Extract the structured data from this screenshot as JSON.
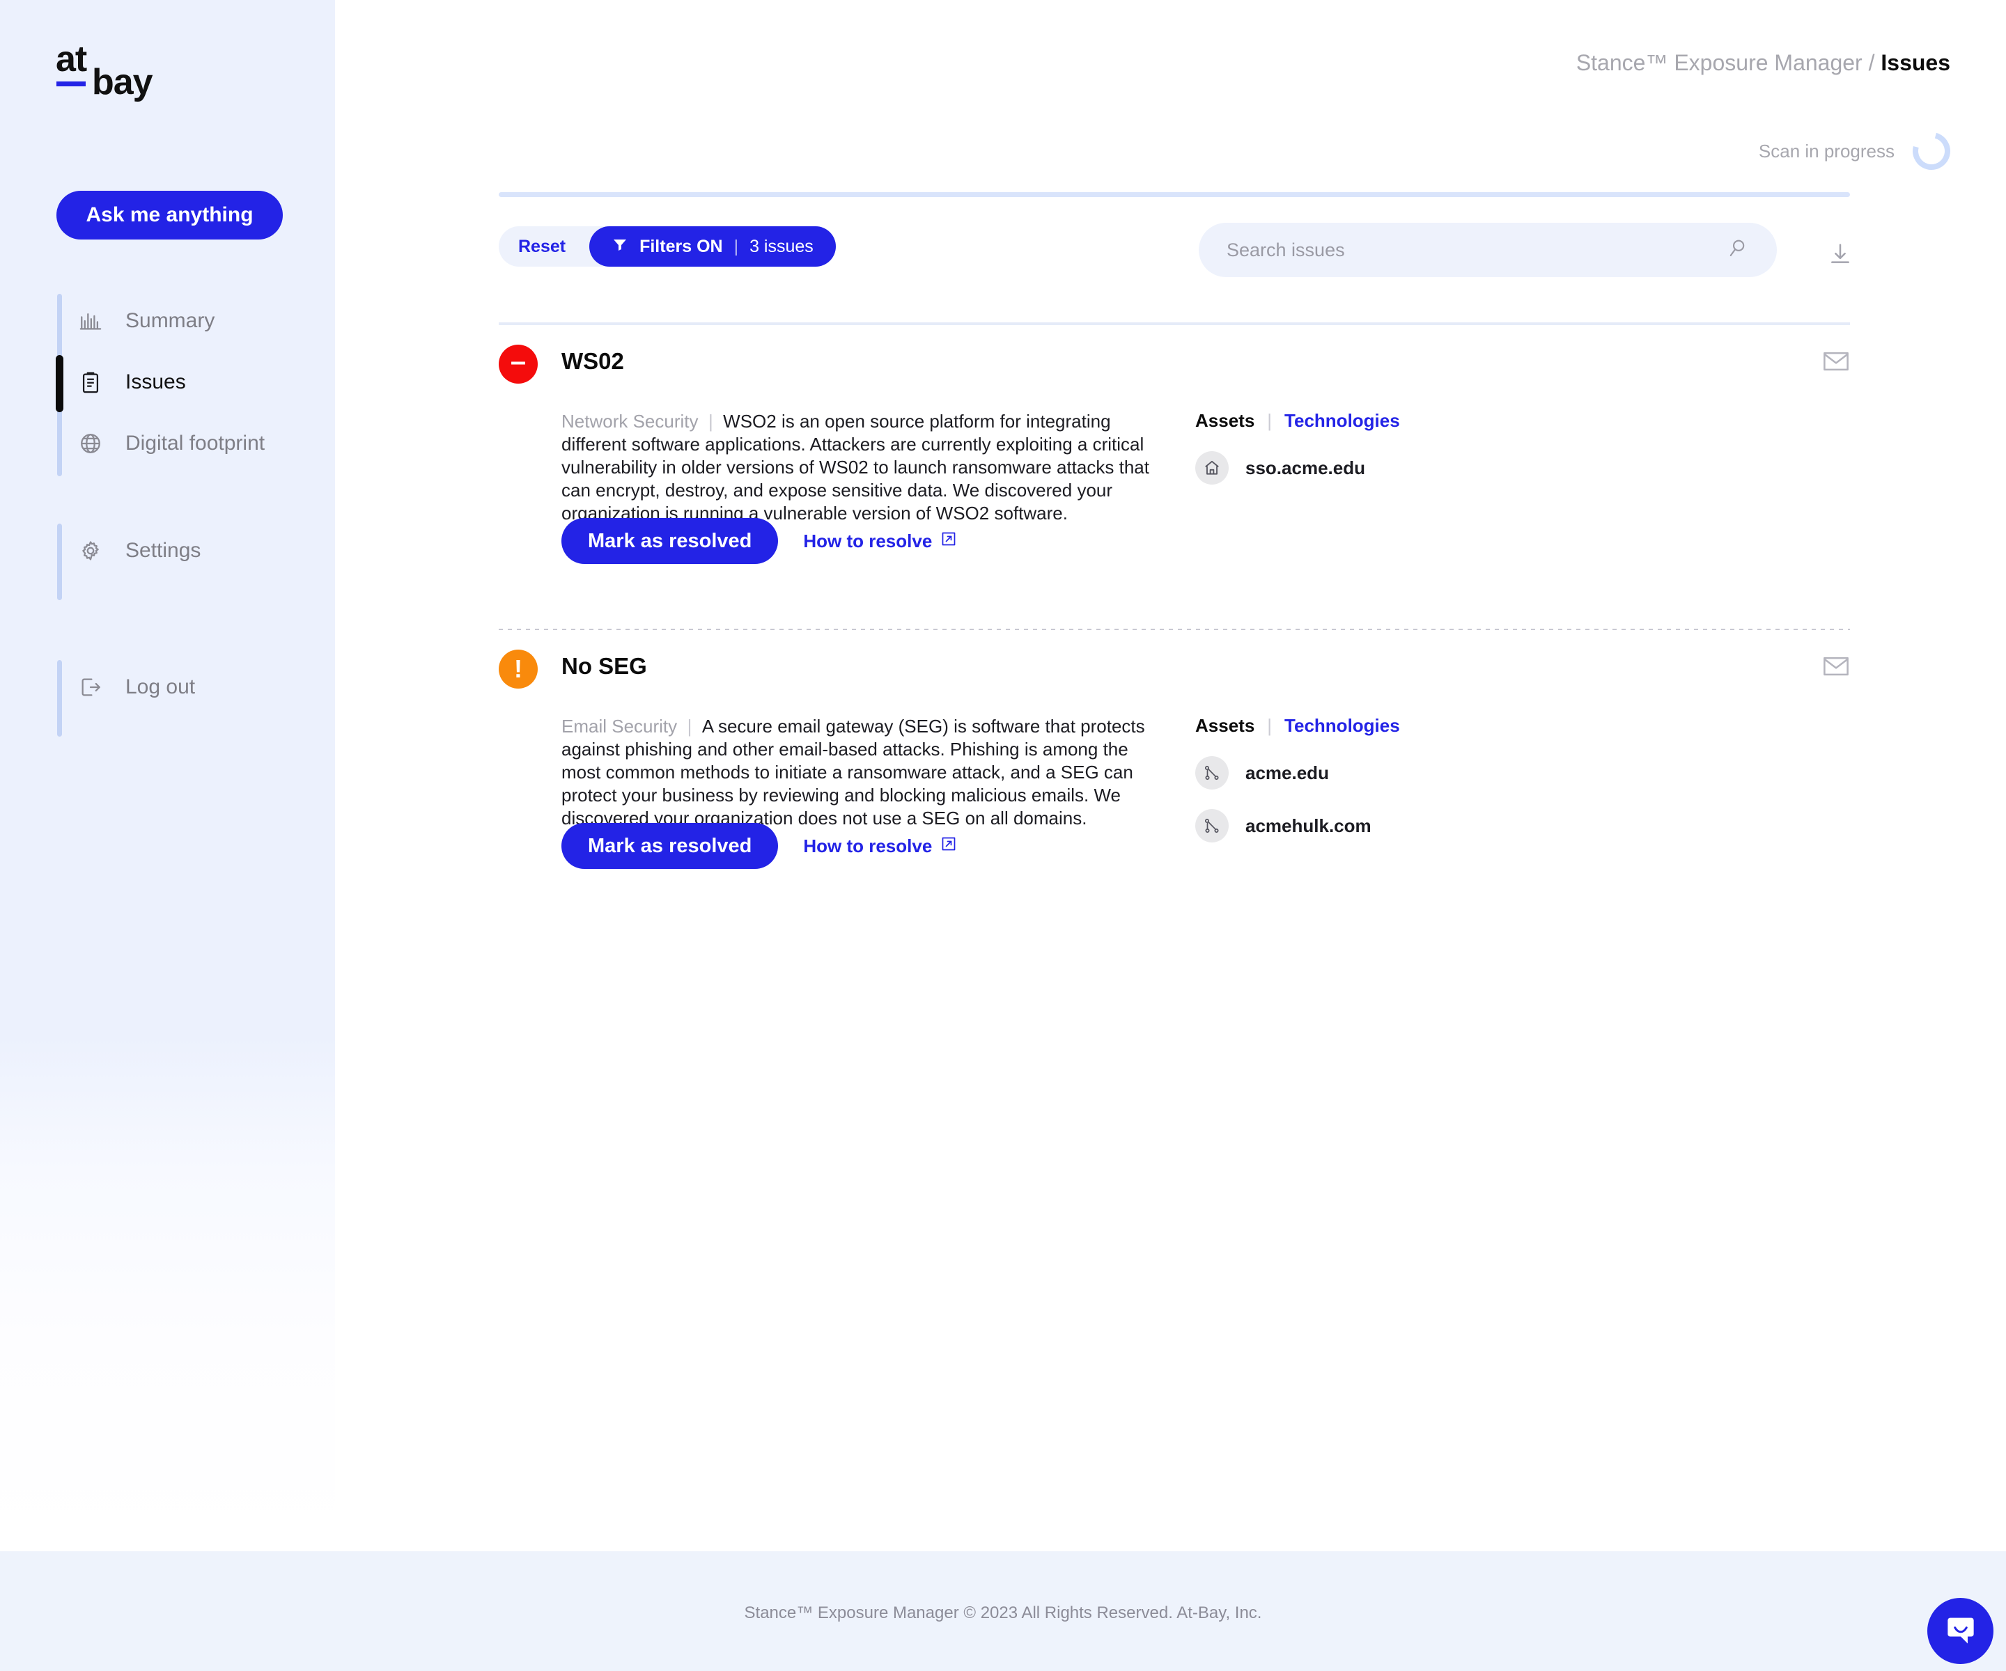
{
  "brand": {
    "logo_top": "at",
    "logo_bottom": "bay",
    "accent": "#2323e6"
  },
  "sidebar": {
    "ask_button": "Ask me anything",
    "groups": [
      {
        "items": [
          {
            "label": "Summary",
            "icon": "bar-chart-icon",
            "active": false
          },
          {
            "label": "Issues",
            "icon": "clipboard-icon",
            "active": true
          },
          {
            "label": "Digital footprint",
            "icon": "globe-icon",
            "active": false
          }
        ]
      },
      {
        "items": [
          {
            "label": "Settings",
            "icon": "gear-icon",
            "active": false
          }
        ]
      },
      {
        "items": [
          {
            "label": "Log out",
            "icon": "logout-icon",
            "active": false
          }
        ]
      }
    ]
  },
  "header": {
    "breadcrumb_parent": "Stance™ Exposure Manager",
    "breadcrumb_separator": " / ",
    "breadcrumb_current": "Issues",
    "scan_status": "Scan in progress"
  },
  "toolbar": {
    "reset_label": "Reset",
    "filters_label": "Filters ON",
    "filters_separator": "|",
    "filters_count": "3 issues",
    "filter_icon": "funnel-icon",
    "download_icon": "download-icon"
  },
  "search": {
    "value": "",
    "placeholder": "Search issues",
    "icon": "search-icon"
  },
  "issues": [
    {
      "title": "WS02",
      "severity": "critical",
      "severity_color": "#f40c0c",
      "severity_icon": "minus-circle-icon",
      "category": "Network Security",
      "description": "WSO2 is an open source platform for integrating different software applications. Attackers are currently exploiting a critical vulnerability in older versions of WS02 to launch ransomware attacks that can encrypt, destroy, and expose sensitive data. We discovered your organization is running a vulnerable version of WSO2 software.",
      "tab_assets": "Assets",
      "tab_technologies": "Technologies",
      "assets": [
        {
          "name": "sso.acme.edu",
          "icon": "home-icon"
        }
      ],
      "resolve_label": "Mark as resolved",
      "howto_label": "How to resolve",
      "howto_icon": "external-link-icon",
      "mail_icon": "envelope-icon"
    },
    {
      "title": "No SEG",
      "severity": "warning",
      "severity_color": "#f98a0c",
      "severity_icon": "exclamation-circle-icon",
      "category": "Email Security",
      "description": "A secure email gateway (SEG) is software that protects against phishing and other email-based attacks. Phishing is among the most common methods to initiate a ransomware attack, and a SEG can protect your business by reviewing and blocking malicious emails. We discovered your organization does not use a SEG on all domains.",
      "tab_assets": "Assets",
      "tab_technologies": "Technologies",
      "assets": [
        {
          "name": "acme.edu",
          "icon": "network-icon"
        },
        {
          "name": "acmehulk.com",
          "icon": "network-icon"
        }
      ],
      "resolve_label": "Mark as resolved",
      "howto_label": "How to resolve",
      "howto_icon": "external-link-icon",
      "mail_icon": "envelope-icon"
    }
  ],
  "footer": {
    "text": "Stance™ Exposure Manager © 2023 All Rights Reserved. At-Bay, Inc.",
    "chat_icon": "chat-bubble-icon"
  }
}
